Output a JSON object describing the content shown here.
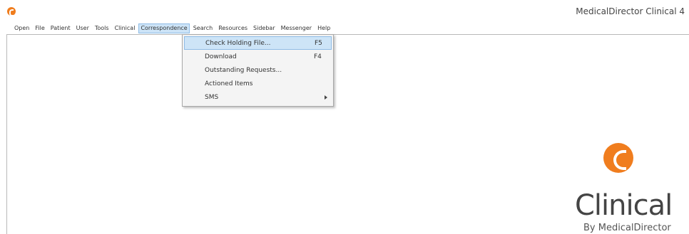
{
  "window": {
    "title": "MedicalDirector Clinical 4",
    "icon": "clinical-logo-icon",
    "accent_color": "#f07d1e"
  },
  "menubar": {
    "items": [
      "Open",
      "File",
      "Patient",
      "User",
      "Tools",
      "Clinical",
      "Correspondence",
      "Search",
      "Resources",
      "Sidebar",
      "Messenger",
      "Help"
    ],
    "active": "Correspondence"
  },
  "dropdown": {
    "items": [
      {
        "label": "Check Holding File...",
        "shortcut": "F5"
      },
      {
        "label": "Download",
        "shortcut": "F4"
      },
      {
        "label": "Outstanding Requests...",
        "shortcut": ""
      },
      {
        "label": "Actioned Items",
        "shortcut": ""
      },
      {
        "label": "SMS",
        "shortcut": "",
        "submenu": true
      }
    ],
    "highlighted": "Check Holding File..."
  },
  "branding": {
    "logo_text": "Clinical",
    "subtitle": "By MedicalDirector"
  }
}
